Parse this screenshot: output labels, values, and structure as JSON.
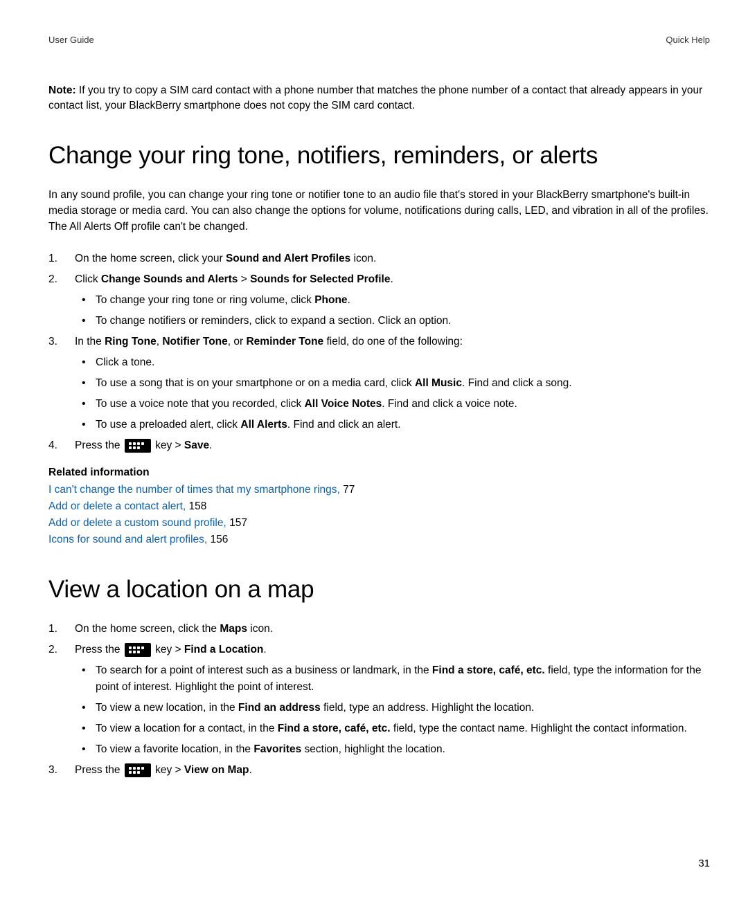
{
  "header": {
    "left": "User Guide",
    "right": "Quick Help"
  },
  "note": {
    "label": "Note:",
    "text": " If you try to copy a SIM card contact with a phone number that matches the phone number of a contact that already appears in your contact list, your BlackBerry smartphone does not copy the SIM card contact."
  },
  "section1": {
    "title": "Change your ring tone, notifiers, reminders, or alerts",
    "intro": "In any sound profile, you can change your ring tone or notifier tone to an audio file that's stored in your BlackBerry smartphone's built-in media storage or media card. You can also change the options for volume, notifications during calls, LED, and vibration in all of the profiles. The All Alerts Off profile can't be changed.",
    "step1": {
      "t1": "On the home screen, click your ",
      "b1": "Sound and Alert Profiles",
      "t2": " icon."
    },
    "step2": {
      "t1": "Click ",
      "b1": "Change Sounds and Alerts",
      "t2": " > ",
      "b2": "Sounds for Selected Profile",
      "t3": "."
    },
    "step2_sub1": {
      "t1": "To change your ring tone or ring volume, click ",
      "b1": "Phone",
      "t2": "."
    },
    "step2_sub2": "To change notifiers or reminders, click to expand a section. Click an option.",
    "step3": {
      "t1": "In the ",
      "b1": "Ring Tone",
      "t2": ", ",
      "b2": "Notifier Tone",
      "t3": ", or ",
      "b3": "Reminder Tone",
      "t4": " field, do one of the following:"
    },
    "step3_sub1": "Click a tone.",
    "step3_sub2": {
      "t1": "To use a song that is on your smartphone or on a media card, click ",
      "b1": "All Music",
      "t2": ". Find and click a song."
    },
    "step3_sub3": {
      "t1": "To use a voice note that you recorded, click ",
      "b1": "All Voice Notes",
      "t2": ". Find and click a voice note."
    },
    "step3_sub4": {
      "t1": "To use a preloaded alert, click ",
      "b1": "All Alerts",
      "t2": ". Find and click an alert."
    },
    "step4": {
      "t1": "Press the ",
      "t2": " key > ",
      "b1": "Save",
      "t3": "."
    },
    "related_title": "Related information",
    "links": [
      {
        "text": "I can't change the number of times that my smartphone rings, ",
        "page": "77"
      },
      {
        "text": "Add or delete a contact alert, ",
        "page": "158"
      },
      {
        "text": "Add or delete a custom sound profile, ",
        "page": "157"
      },
      {
        "text": "Icons for sound and alert profiles, ",
        "page": "156"
      }
    ]
  },
  "section2": {
    "title": "View a location on a map",
    "step1": {
      "t1": "On the home screen, click the ",
      "b1": "Maps",
      "t2": " icon."
    },
    "step2": {
      "t1": "Press the ",
      "t2": " key > ",
      "b1": "Find a Location",
      "t3": "."
    },
    "step2_sub1": {
      "t1": "To search for a point of interest such as a business or landmark, in the ",
      "b1": "Find a store, café, etc.",
      "t2": " field, type the information for the point of interest. Highlight the point of interest."
    },
    "step2_sub2": {
      "t1": "To view a new location, in the ",
      "b1": "Find an address",
      "t2": " field, type an address. Highlight the location."
    },
    "step2_sub3": {
      "t1": "To view a location for a contact, in the ",
      "b1": "Find a store, café, etc.",
      "t2": " field, type the contact name. Highlight the contact information."
    },
    "step2_sub4": {
      "t1": "To view a favorite location, in the ",
      "b1": "Favorites",
      "t2": " section, highlight the location."
    },
    "step3": {
      "t1": "Press the ",
      "t2": " key > ",
      "b1": "View on Map",
      "t3": "."
    }
  },
  "page_number": "31"
}
